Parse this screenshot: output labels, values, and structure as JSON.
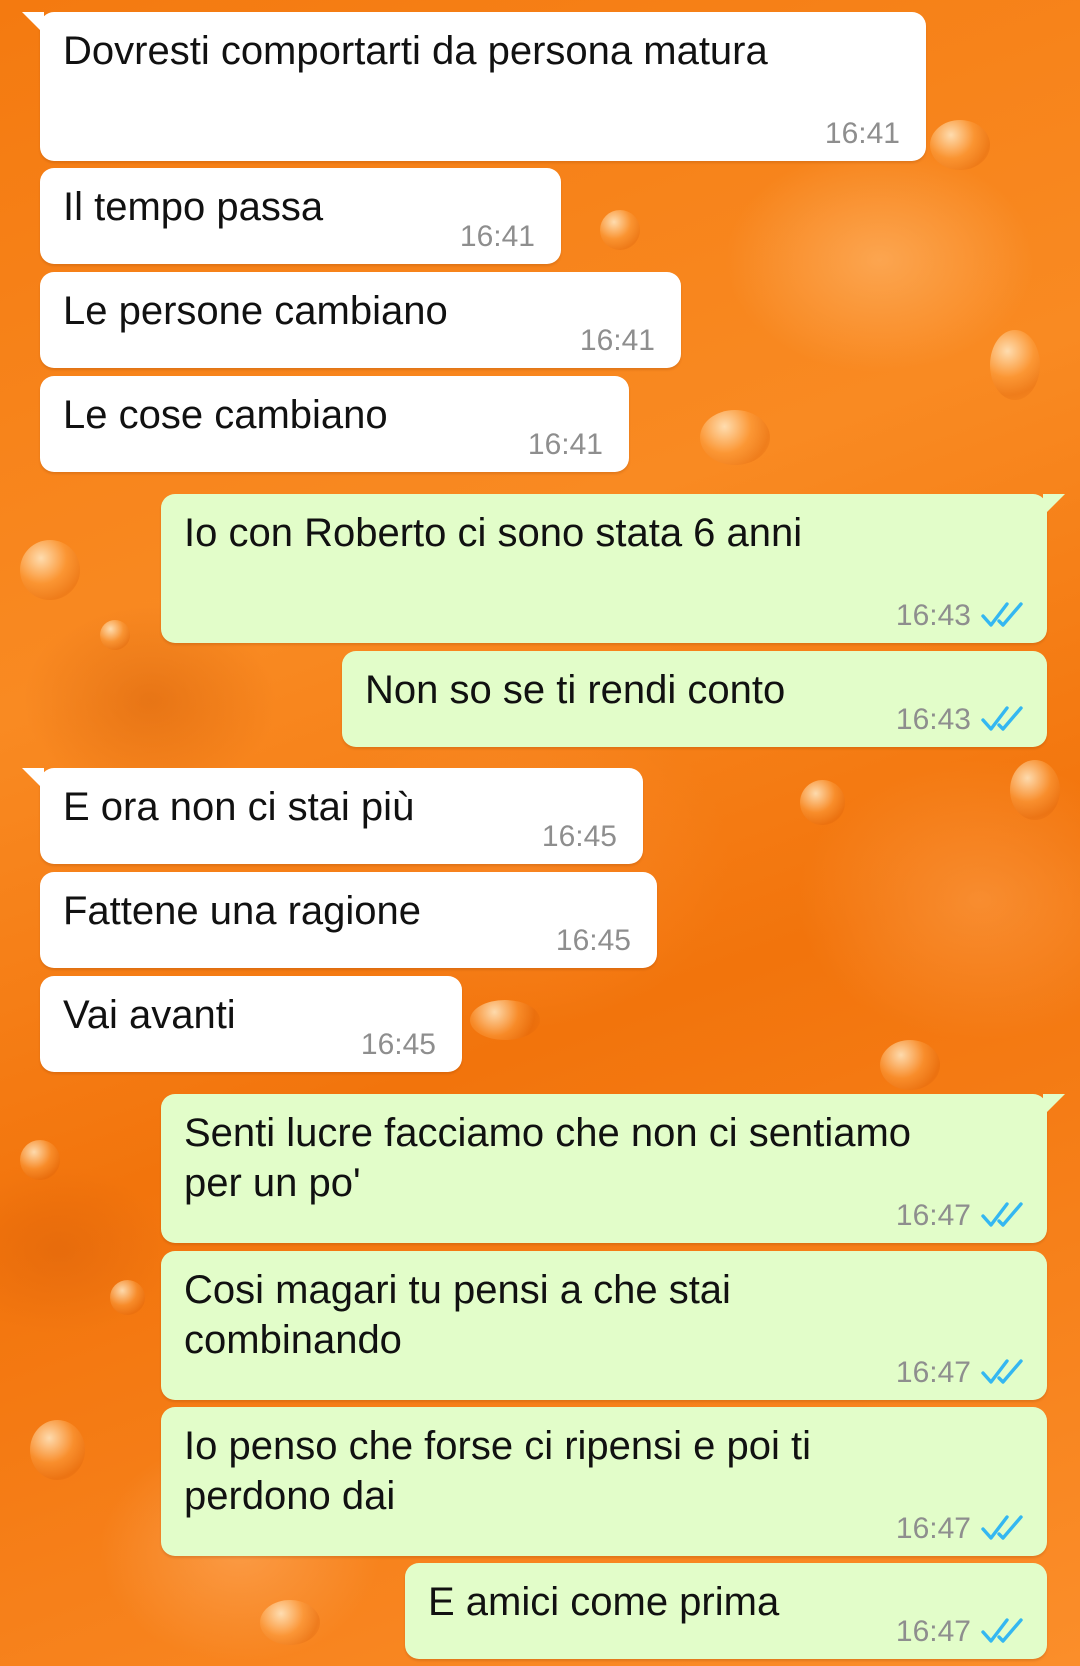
{
  "colors": {
    "background": "#f47a10",
    "incoming_bubble": "#ffffff",
    "outgoing_bubble": "#e2fdc9",
    "timestamp": "#8e8e8e",
    "read_ticks": "#34b7f1"
  },
  "messages": [
    {
      "direction": "in",
      "text": "Dovresti comportarti da persona matura",
      "time": "16:41"
    },
    {
      "direction": "in",
      "text": "Il tempo passa",
      "time": "16:41"
    },
    {
      "direction": "in",
      "text": "Le persone cambiano",
      "time": "16:41"
    },
    {
      "direction": "in",
      "text": "Le cose cambiano",
      "time": "16:41"
    },
    {
      "direction": "out",
      "text": "Io con Roberto ci sono stata 6 anni",
      "time": "16:43",
      "status": "read-double-check-icon"
    },
    {
      "direction": "out",
      "text": "Non so se ti rendi conto",
      "time": "16:43",
      "status": "read-double-check-icon"
    },
    {
      "direction": "in",
      "text": "E ora non ci stai più",
      "time": "16:45"
    },
    {
      "direction": "in",
      "text": "Fattene una ragione",
      "time": "16:45"
    },
    {
      "direction": "in",
      "text": "Vai avanti",
      "time": "16:45"
    },
    {
      "direction": "out",
      "text": "Senti lucre facciamo che non ci sentiamo\nper un po'",
      "time": "16:47",
      "status": "read-double-check-icon"
    },
    {
      "direction": "out",
      "text": "Cosi magari tu pensi a che stai\ncombinando",
      "time": "16:47",
      "status": "read-double-check-icon"
    },
    {
      "direction": "out",
      "text": "Io penso che forse ci ripensi e poi ti\nperdono dai",
      "time": "16:47",
      "status": "read-double-check-icon"
    },
    {
      "direction": "out",
      "text": "E amici come prima",
      "time": "16:47",
      "status": "read-double-check-icon"
    }
  ]
}
